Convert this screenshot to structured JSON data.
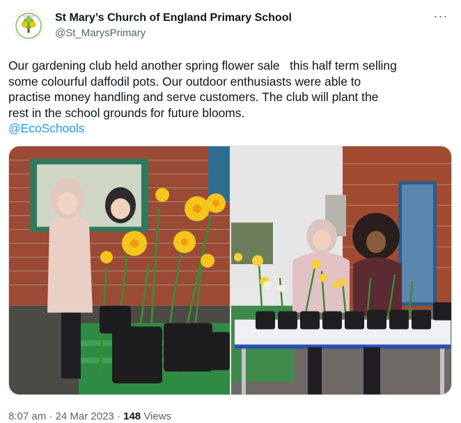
{
  "author": {
    "display_name": "St Mary’s Church of England Primary School",
    "handle": "@St_MarysPrimary",
    "avatar_icon": "tree-logo-icon"
  },
  "more_icon": "more-options-icon",
  "more_label": "···",
  "tweet": {
    "text": "Our gardening club held another spring flower sale   this half term selling\nsome colourful daffodil pots. Our outdoor enthusiasts were able to\npractise money handling and serve customers. The club will plant the\nrest in the school grounds for future blooms.",
    "mention": "@EcoSchools"
  },
  "media": {
    "photos": [
      {
        "name": "photo-left",
        "icon": "photo-daffodils-left"
      },
      {
        "name": "photo-right",
        "icon": "photo-daffodils-right"
      }
    ]
  },
  "meta": {
    "time": "8:07 am",
    "separator_1": " · ",
    "date": "24 Mar 2023",
    "separator_2": " · ",
    "views_count": "148",
    "views_label": " Views"
  },
  "colors": {
    "link": "#1d9bf0",
    "secondary_text": "#536471",
    "primary_text": "#0f1419",
    "logo_green": "#5cb531",
    "logo_yellow": "#f2c318"
  }
}
